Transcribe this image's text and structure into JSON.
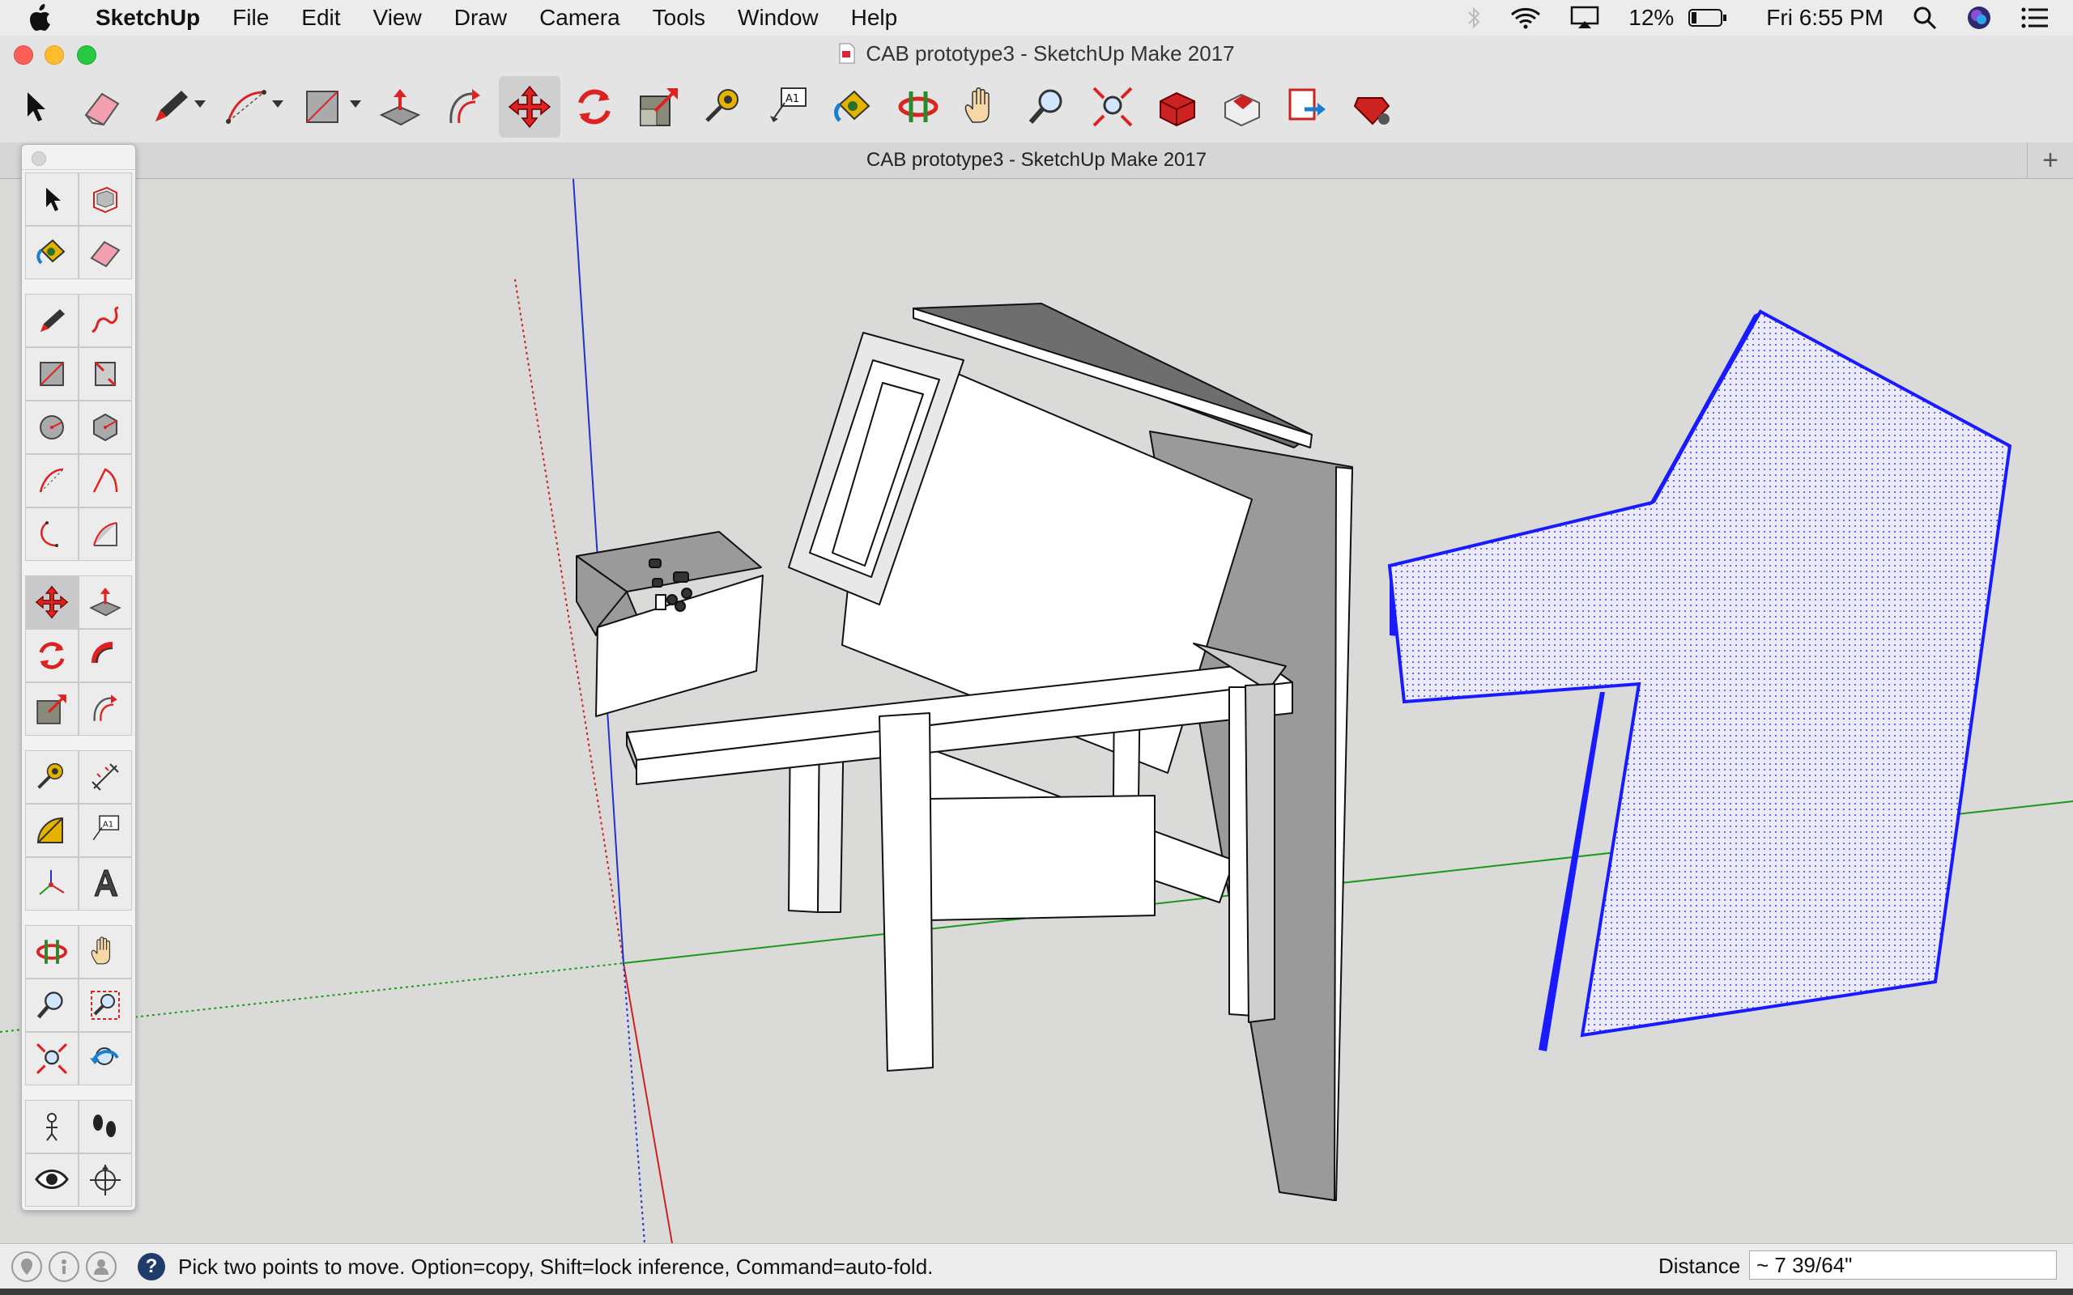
{
  "menubar": {
    "apple_icon": "apple-icon",
    "items": [
      "SketchUp",
      "File",
      "Edit",
      "View",
      "Draw",
      "Camera",
      "Tools",
      "Window",
      "Help"
    ],
    "battery": "12%",
    "clock": "Fri 6:55 PM",
    "status_icons": [
      "bluetooth-icon",
      "wifi-icon",
      "airplay-icon",
      "battery-icon",
      "spotlight-search-icon",
      "siri-icon",
      "notification-center-icon"
    ]
  },
  "window": {
    "title": "CAB prototype3 - SketchUp Make 2017"
  },
  "toolbar": {
    "tools": [
      "select",
      "eraser",
      "line",
      "arc",
      "rectangle",
      "push-pull",
      "offset",
      "move",
      "rotate",
      "scale",
      "tape-measure",
      "text",
      "paint-bucket",
      "orbit",
      "pan",
      "zoom",
      "zoom-extents",
      "3d-warehouse",
      "extension-warehouse",
      "layout",
      "extension-manager"
    ],
    "active": "move"
  },
  "tabbar": {
    "tab_title": "CAB prototype3 - SketchUp Make 2017",
    "add_label": "+"
  },
  "palette": {
    "tools": [
      "select",
      "component",
      "paint-bucket",
      "eraser",
      "line",
      "freehand",
      "rectangle",
      "rotated-rectangle",
      "circle",
      "polygon",
      "arc",
      "pie",
      "2-point-arc",
      "3-point-arc",
      "move",
      "push-pull",
      "rotate",
      "follow-me",
      "scale",
      "offset",
      "tape-measure",
      "dimensions",
      "protractor",
      "text",
      "axes",
      "3d-text",
      "orbit",
      "pan",
      "zoom",
      "zoom-window",
      "zoom-extents",
      "previous-view",
      "position-camera",
      "walk",
      "look-around",
      "section-plane"
    ],
    "active": "move"
  },
  "statusbar": {
    "hint": "Pick two points to move.  Option=copy, Shift=lock inference, Command=auto-fold.",
    "measure_label": "Distance",
    "measure_value": "~ 7 39/64\""
  },
  "colors": {
    "selection": "#1a1aff",
    "axis_red": "#cc2222",
    "axis_green": "#1a9a1a",
    "axis_blue": "#2233cc"
  }
}
